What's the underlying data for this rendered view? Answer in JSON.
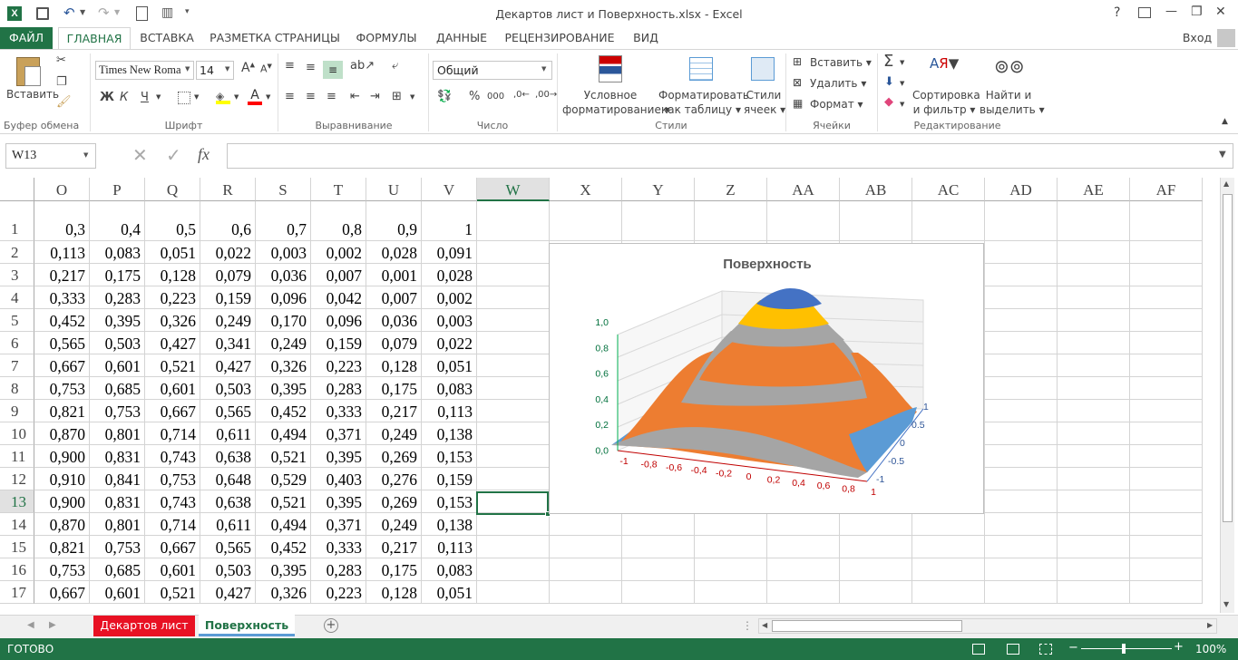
{
  "title": "Декартов лист и Поверхность.xlsx - Excel",
  "titlebar": {
    "help": "?",
    "minimize": "—",
    "restore": "❐",
    "close": "✕"
  },
  "tabs": [
    "ФАЙЛ",
    "ГЛАВНАЯ",
    "ВСТАВКА",
    "РАЗМЕТКА СТРАНИЦЫ",
    "ФОРМУЛЫ",
    "ДАННЫЕ",
    "РЕЦЕНЗИРОВАНИЕ",
    "ВИД"
  ],
  "signin": "Вход",
  "ribbon": {
    "paste": "Вставить",
    "clipboard": "Буфер обмена",
    "font_name": "Times New Roma",
    "font_size": "14",
    "bold": "Ж",
    "italic": "К",
    "underline": "Ч",
    "font_group": "Шрифт",
    "align_group": "Выравнивание",
    "number_format": "Общий",
    "number_group": "Число",
    "cond_format_1": "Условное",
    "cond_format_2": "форматирование",
    "format_table_1": "Форматировать",
    "format_table_2": "как таблицу",
    "cell_styles_1": "Стили",
    "cell_styles_2": "ячеек",
    "styles_group": "Стили",
    "insert": "Вставить",
    "delete": "Удалить",
    "format": "Формат",
    "cells_group": "Ячейки",
    "sort_1": "Сортировка",
    "sort_2": "и фильтр",
    "find_1": "Найти и",
    "find_2": "выделить",
    "editing_group": "Редактирование"
  },
  "formula_bar": {
    "name_box": "W13",
    "fx": "fx",
    "value": ""
  },
  "columns": [
    "O",
    "P",
    "Q",
    "R",
    "S",
    "T",
    "U",
    "V",
    "W",
    "X",
    "Y",
    "Z",
    "AA",
    "AB",
    "AC",
    "AD",
    "AE",
    "AF"
  ],
  "rows": [
    {
      "n": "1",
      "v": [
        "0,3",
        "0,4",
        "0,5",
        "0,6",
        "0,7",
        "0,8",
        "0,9",
        "1"
      ]
    },
    {
      "n": "2",
      "v": [
        "0,113",
        "0,083",
        "0,051",
        "0,022",
        "0,003",
        "0,002",
        "0,028",
        "0,091"
      ]
    },
    {
      "n": "3",
      "v": [
        "0,217",
        "0,175",
        "0,128",
        "0,079",
        "0,036",
        "0,007",
        "0,001",
        "0,028"
      ]
    },
    {
      "n": "4",
      "v": [
        "0,333",
        "0,283",
        "0,223",
        "0,159",
        "0,096",
        "0,042",
        "0,007",
        "0,002"
      ]
    },
    {
      "n": "5",
      "v": [
        "0,452",
        "0,395",
        "0,326",
        "0,249",
        "0,170",
        "0,096",
        "0,036",
        "0,003"
      ]
    },
    {
      "n": "6",
      "v": [
        "0,565",
        "0,503",
        "0,427",
        "0,341",
        "0,249",
        "0,159",
        "0,079",
        "0,022"
      ]
    },
    {
      "n": "7",
      "v": [
        "0,667",
        "0,601",
        "0,521",
        "0,427",
        "0,326",
        "0,223",
        "0,128",
        "0,051"
      ]
    },
    {
      "n": "8",
      "v": [
        "0,753",
        "0,685",
        "0,601",
        "0,503",
        "0,395",
        "0,283",
        "0,175",
        "0,083"
      ]
    },
    {
      "n": "9",
      "v": [
        "0,821",
        "0,753",
        "0,667",
        "0,565",
        "0,452",
        "0,333",
        "0,217",
        "0,113"
      ]
    },
    {
      "n": "10",
      "v": [
        "0,870",
        "0,801",
        "0,714",
        "0,611",
        "0,494",
        "0,371",
        "0,249",
        "0,138"
      ]
    },
    {
      "n": "11",
      "v": [
        "0,900",
        "0,831",
        "0,743",
        "0,638",
        "0,521",
        "0,395",
        "0,269",
        "0,153"
      ]
    },
    {
      "n": "12",
      "v": [
        "0,910",
        "0,841",
        "0,753",
        "0,648",
        "0,529",
        "0,403",
        "0,276",
        "0,159"
      ]
    },
    {
      "n": "13",
      "v": [
        "0,900",
        "0,831",
        "0,743",
        "0,638",
        "0,521",
        "0,395",
        "0,269",
        "0,153"
      ]
    },
    {
      "n": "14",
      "v": [
        "0,870",
        "0,801",
        "0,714",
        "0,611",
        "0,494",
        "0,371",
        "0,249",
        "0,138"
      ]
    },
    {
      "n": "15",
      "v": [
        "0,821",
        "0,753",
        "0,667",
        "0,565",
        "0,452",
        "0,333",
        "0,217",
        "0,113"
      ]
    },
    {
      "n": "16",
      "v": [
        "0,753",
        "0,685",
        "0,601",
        "0,503",
        "0,395",
        "0,283",
        "0,175",
        "0,083"
      ]
    },
    {
      "n": "17",
      "v": [
        "0,667",
        "0,601",
        "0,521",
        "0,427",
        "0,326",
        "0,223",
        "0,128",
        "0,051"
      ]
    }
  ],
  "chart_data": {
    "type": "surface",
    "title": "Поверхность",
    "z_ticks": [
      "1,0",
      "0,8",
      "0,6",
      "0,4",
      "0,2",
      "0,0"
    ],
    "x_ticks": [
      "-1",
      "-0,8",
      "-0,6",
      "-0,4",
      "-0,2",
      "0",
      "0,2",
      "0,4",
      "0,6",
      "0,8",
      "1"
    ],
    "y_ticks": [
      "1",
      "0.5",
      "0",
      "-0.5",
      "-1"
    ],
    "bands": [
      "#4472c4",
      "#ffc000",
      "#a5a5a5",
      "#ed7d31",
      "#a5a5a5",
      "#5b9bd5"
    ]
  },
  "sheets": [
    "Декартов лист",
    "Поверхность"
  ],
  "status": {
    "ready": "ГОТОВО",
    "zoom": "100%"
  },
  "colors": {
    "excel_green": "#217346",
    "active_sheet_red": "#e81123"
  }
}
